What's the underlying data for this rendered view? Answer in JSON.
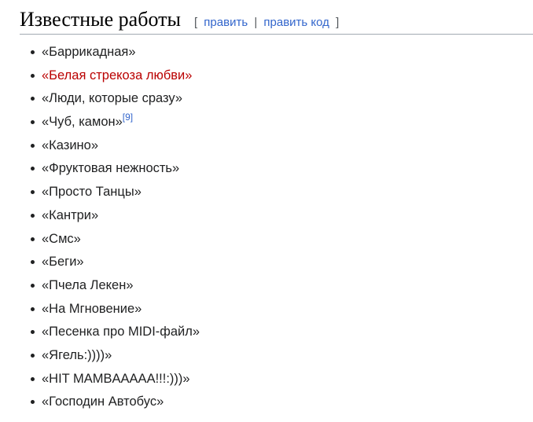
{
  "section": {
    "title": "Известные работы",
    "edit": {
      "open_bracket": "[",
      "edit_label": "править",
      "separator": "|",
      "edit_code_label": "править код",
      "close_bracket": "]"
    }
  },
  "works": [
    {
      "text": "«Баррикадная»"
    },
    {
      "text": "«Белая стрекоза любви»"
    },
    {
      "text": "«Люди, которые сразу»"
    },
    {
      "text": "«Чуб, камон»",
      "ref": "[9]"
    },
    {
      "text": "«Казино»"
    },
    {
      "text": "«Фруктовая нежность»"
    },
    {
      "text": "«Просто Танцы»"
    },
    {
      "text": "«Кантри»"
    },
    {
      "text": "«Смс»"
    },
    {
      "text": "«Беги»"
    },
    {
      "text": "«Пчела Лекен»"
    },
    {
      "text": "«На Мгновение»"
    },
    {
      "text": "«Песенка про MIDI-файл»"
    },
    {
      "text": "«Ягель:))))»"
    },
    {
      "text": "«HIT MAMBAAAAA!!!:)))»"
    },
    {
      "text": "«Господин Автобус»"
    }
  ],
  "colors": {
    "text": "#202122",
    "link": "#3366cc",
    "redlink": "#ba0000",
    "rule": "#a2a9b1"
  }
}
